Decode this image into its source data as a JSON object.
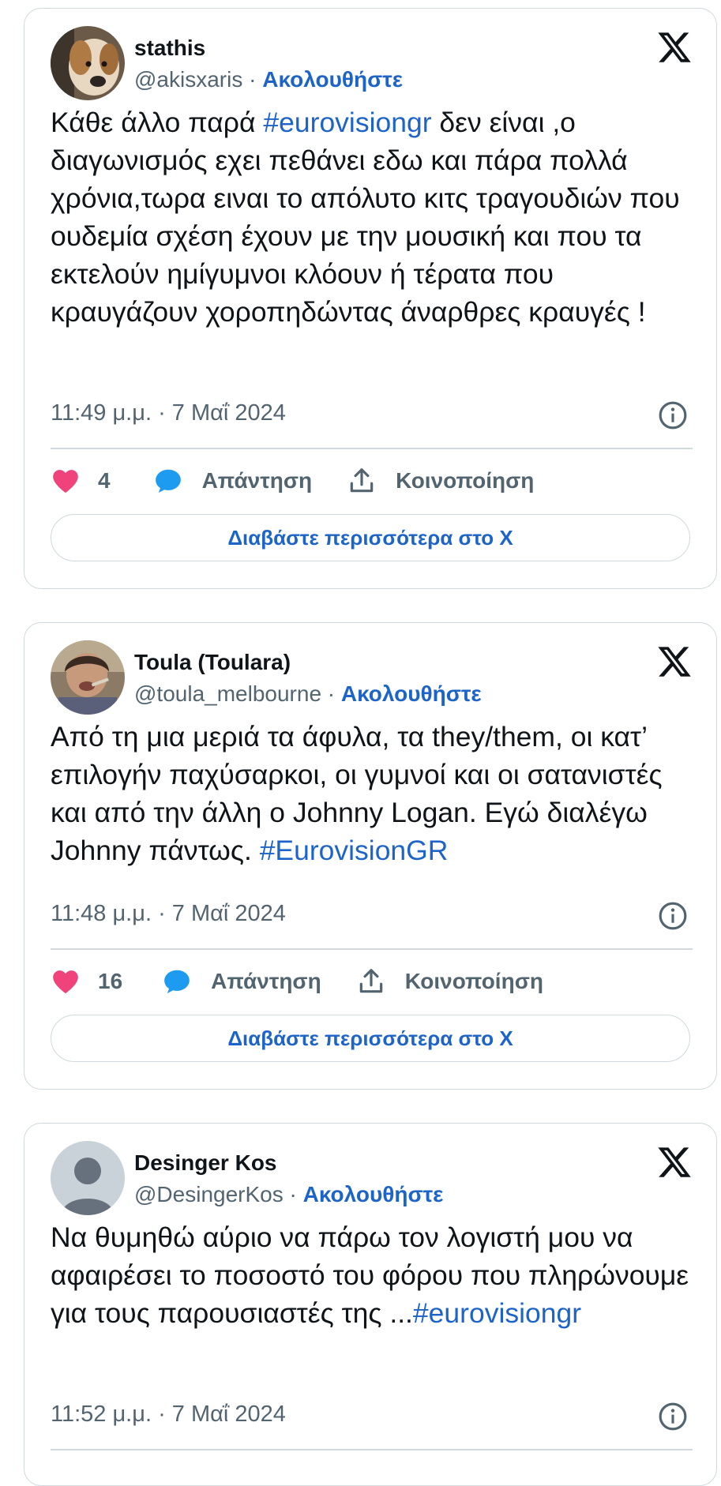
{
  "tweets": [
    {
      "name": "stathis",
      "handle": "@akisxaris",
      "separator": " · ",
      "follow_label": "Ακολουθήστε",
      "text_before": "Κάθε άλλο παρά ",
      "hashtag": "#eurovisiongr",
      "text_after": " δεν είναι ,ο διαγωνισμός εχει πεθάνει εδω και πάρα πολλά χρόνια,τωρα ειναι το απόλυτο κιτς τραγουδιών που ουδεμία σχέση έχουν με την μουσική και που τα εκτελούν ημίγυμνοι κλόουν ή τέρατα που κραυγάζουν χοροπηδώντας άναρθρες κραυγές !",
      "timestamp": "11:49 μ.μ. · 7 Μαΐ 2024",
      "likes": "4",
      "reply_label": "Απάντηση",
      "share_label": "Κοινοποίηση",
      "read_more_label": "Διαβάστε περισσότερα στο X",
      "icons": [
        "x-logo-icon",
        "info-icon",
        "heart-icon",
        "reply-bubble-icon",
        "share-upload-icon"
      ]
    },
    {
      "name": "Toula (Toulara)",
      "handle": "@toula_melbourne",
      "separator": " · ",
      "follow_label": "Ακολουθήστε",
      "text_before": "Από τη μια μεριά τα άφυλα, τα they/them, οι κατ’ επιλογήν παχύσαρκοι, οι γυμνοί και οι σατανιστές και από την άλλη ο Johnny Logan. Εγώ διαλέγω Johnny πάντως. ",
      "hashtag": "#EurovisionGR",
      "text_after": "",
      "timestamp": "11:48 μ.μ. · 7 Μαΐ 2024",
      "likes": "16",
      "reply_label": "Απάντηση",
      "share_label": "Κοινοποίηση",
      "read_more_label": "Διαβάστε περισσότερα στο X",
      "icons": [
        "x-logo-icon",
        "info-icon",
        "heart-icon",
        "reply-bubble-icon",
        "share-upload-icon"
      ]
    },
    {
      "name": "Desinger Kos",
      "handle": "@DesingerKos",
      "separator": " · ",
      "follow_label": "Ακολουθήστε",
      "text_before": "Να θυμηθώ αύριο να πάρω τον λογιστή μου να αφαιρέσει το ποσοστό του φόρου που πληρώνουμε για τους παρουσιαστές της ...",
      "hashtag": "#eurovisiongr",
      "text_after": "",
      "timestamp": "11:52 μ.μ. · 7 Μαΐ 2024",
      "icons": [
        "x-logo-icon",
        "info-icon",
        "default-avatar-icon"
      ]
    }
  ],
  "colors": {
    "link_blue": "#1d64c8",
    "secondary_text": "#536471",
    "border": "#cfd9de",
    "like_pink": "#f0437c",
    "reply_blue": "#1d9bf0"
  }
}
